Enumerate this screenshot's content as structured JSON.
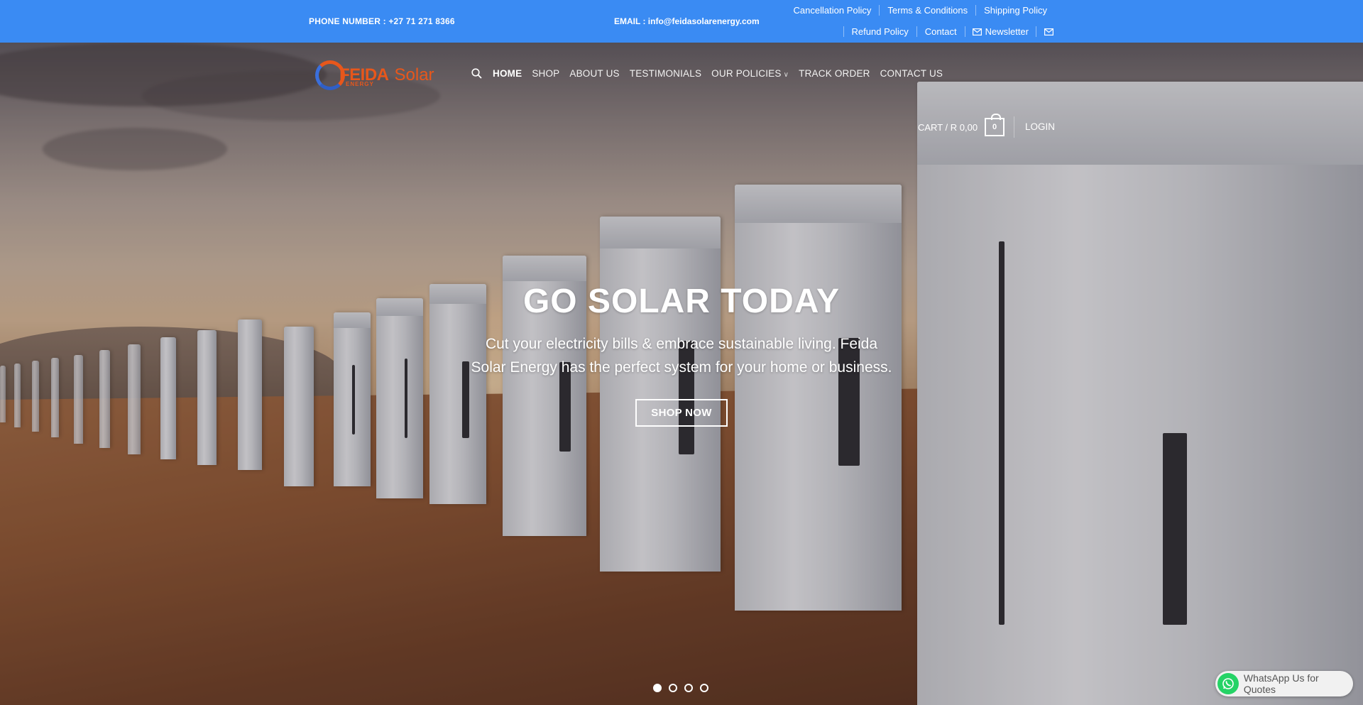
{
  "topbar": {
    "phone": "PHONE NUMBER : +27 71 271 8366",
    "email": "EMAIL : info@feidasolarenergy.com",
    "links_row1": [
      "Cancellation Policy",
      "Terms & Conditions",
      "Shipping Policy"
    ],
    "links_row2": [
      "Refund Policy",
      "Contact"
    ],
    "newsletter": "Newsletter",
    "bg_color": "#3a8bf3"
  },
  "logo": {
    "brand": "FEIDA",
    "solar": "Solar",
    "energy": "ENERGY"
  },
  "nav": {
    "items": [
      "HOME",
      "SHOP",
      "ABOUT US",
      "TESTIMONIALS",
      "OUR POLICIES",
      "TRACK ORDER",
      "CONTACT US"
    ],
    "active": "HOME"
  },
  "cart": {
    "label": "CART / R 0,00",
    "count": "0"
  },
  "login": "LOGIN",
  "hero": {
    "headline": "GO SOLAR TODAY",
    "subline": "Cut your electricity bills & embrace sustainable living. Feida Solar Energy has the perfect system for your home or business.",
    "button": "SHOP NOW",
    "slides": 4,
    "current_slide": 1
  },
  "whatsapp": {
    "label": "WhatsApp Us for Quotes",
    "color": "#25d366"
  }
}
